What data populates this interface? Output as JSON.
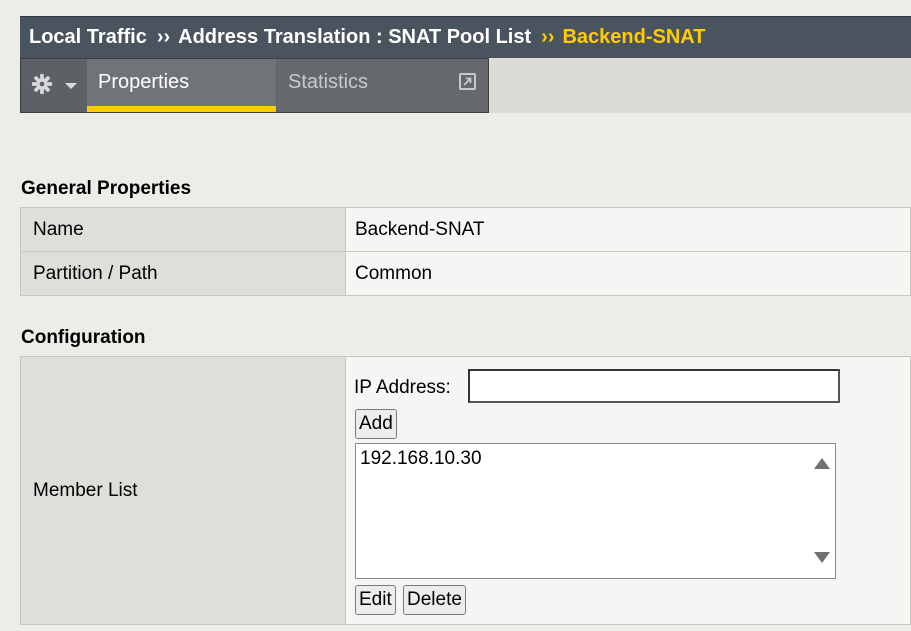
{
  "breadcrumb": {
    "items": [
      "Local Traffic",
      "Address Translation : SNAT Pool List"
    ],
    "separator": "››",
    "current": "Backend-SNAT"
  },
  "tabs": {
    "gear_menu": "gear-icon",
    "properties": "Properties",
    "statistics": "Statistics"
  },
  "general": {
    "title": "General Properties",
    "rows": [
      {
        "label": "Name",
        "value": "Backend-SNAT"
      },
      {
        "label": "Partition / Path",
        "value": "Common"
      }
    ]
  },
  "configuration": {
    "title": "Configuration",
    "member_list_label": "Member List",
    "ip_label": "IP Address:",
    "ip_value": "",
    "add_label": "Add",
    "members": [
      "192.168.10.30"
    ],
    "edit_label": "Edit",
    "delete_label": "Delete"
  },
  "colors": {
    "accent": "#ffcc00",
    "header_bg": "#4a545e",
    "page_bg": "#edece8"
  }
}
